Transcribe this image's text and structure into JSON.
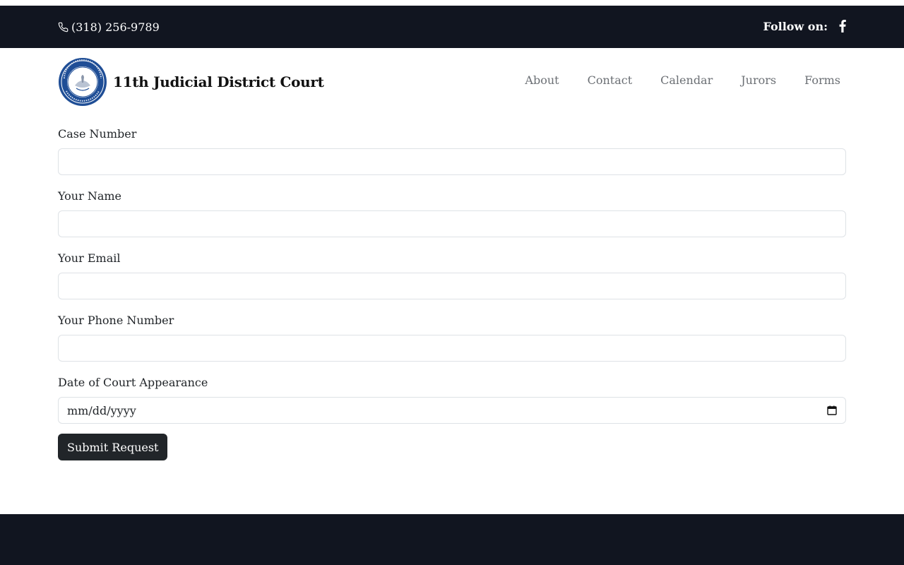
{
  "topbar": {
    "phone_icon": "phone-icon",
    "phone": "(318) 256-9789",
    "follow_label": "Follow on:",
    "social_icon": "facebook-icon"
  },
  "header": {
    "seal_icon": "court-seal-logo",
    "site_name": "11th Judicial District Court",
    "nav": [
      "About",
      "Contact",
      "Calendar",
      "Jurors",
      "Forms"
    ]
  },
  "form": {
    "fields": [
      {
        "label": "Case Number",
        "value": ""
      },
      {
        "label": "Your Name",
        "value": ""
      },
      {
        "label": "Your Email",
        "value": ""
      },
      {
        "label": "Your Phone Number",
        "value": ""
      },
      {
        "label": "Date of Court Appearance",
        "value": "mm/dd/yyyy"
      }
    ],
    "date_icon": "calendar-icon",
    "submit_label": "Submit Request"
  },
  "colors": {
    "dark_bar": "#111520",
    "button": "#212529",
    "nav_text": "#6b6f74",
    "seal_blue": "#1f4e96"
  }
}
